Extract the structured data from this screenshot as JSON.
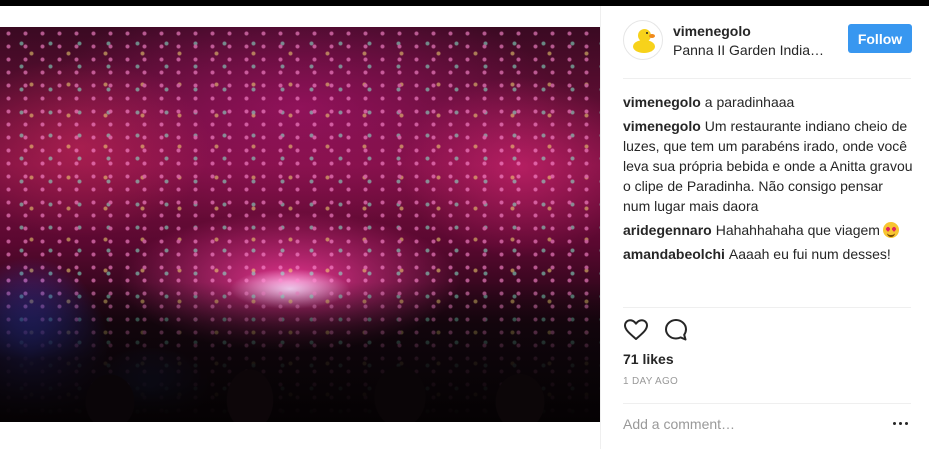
{
  "post": {
    "photo_icon": "restaurant-lights-photo",
    "header": {
      "username": "vimenegolo",
      "location": "Panna II Garden India…",
      "follow_label": "Follow",
      "avatar_icon": "rubber-duck-avatar"
    },
    "comments": [
      {
        "author": "vimenegolo",
        "text": "a paradinhaaa"
      },
      {
        "author": "vimenegolo",
        "text": "Um restaurante indiano cheio de luzes, que tem um parabéns irado, onde você leva sua própria bebida e onde a Anitta gravou o clipe de Paradinha. Não consigo pensar num lugar mais daora"
      },
      {
        "author": "aridegennaro",
        "text": "Hahahhahaha que viagem",
        "emoji": "heart-eyes-emoji"
      },
      {
        "author": "amandabeolchi",
        "text": "Aaaah eu fui num desses!"
      }
    ],
    "actions": {
      "like_icon": "heart-icon",
      "comment_icon": "comment-bubble-icon"
    },
    "likes": "71 likes",
    "time": "1 DAY AGO",
    "add_comment_placeholder": "Add a comment…",
    "more_icon": "more-options-icon"
  },
  "colors": {
    "follow_button": "#3897f0",
    "text": "#262626",
    "muted": "#999999",
    "divider": "#efefef"
  }
}
